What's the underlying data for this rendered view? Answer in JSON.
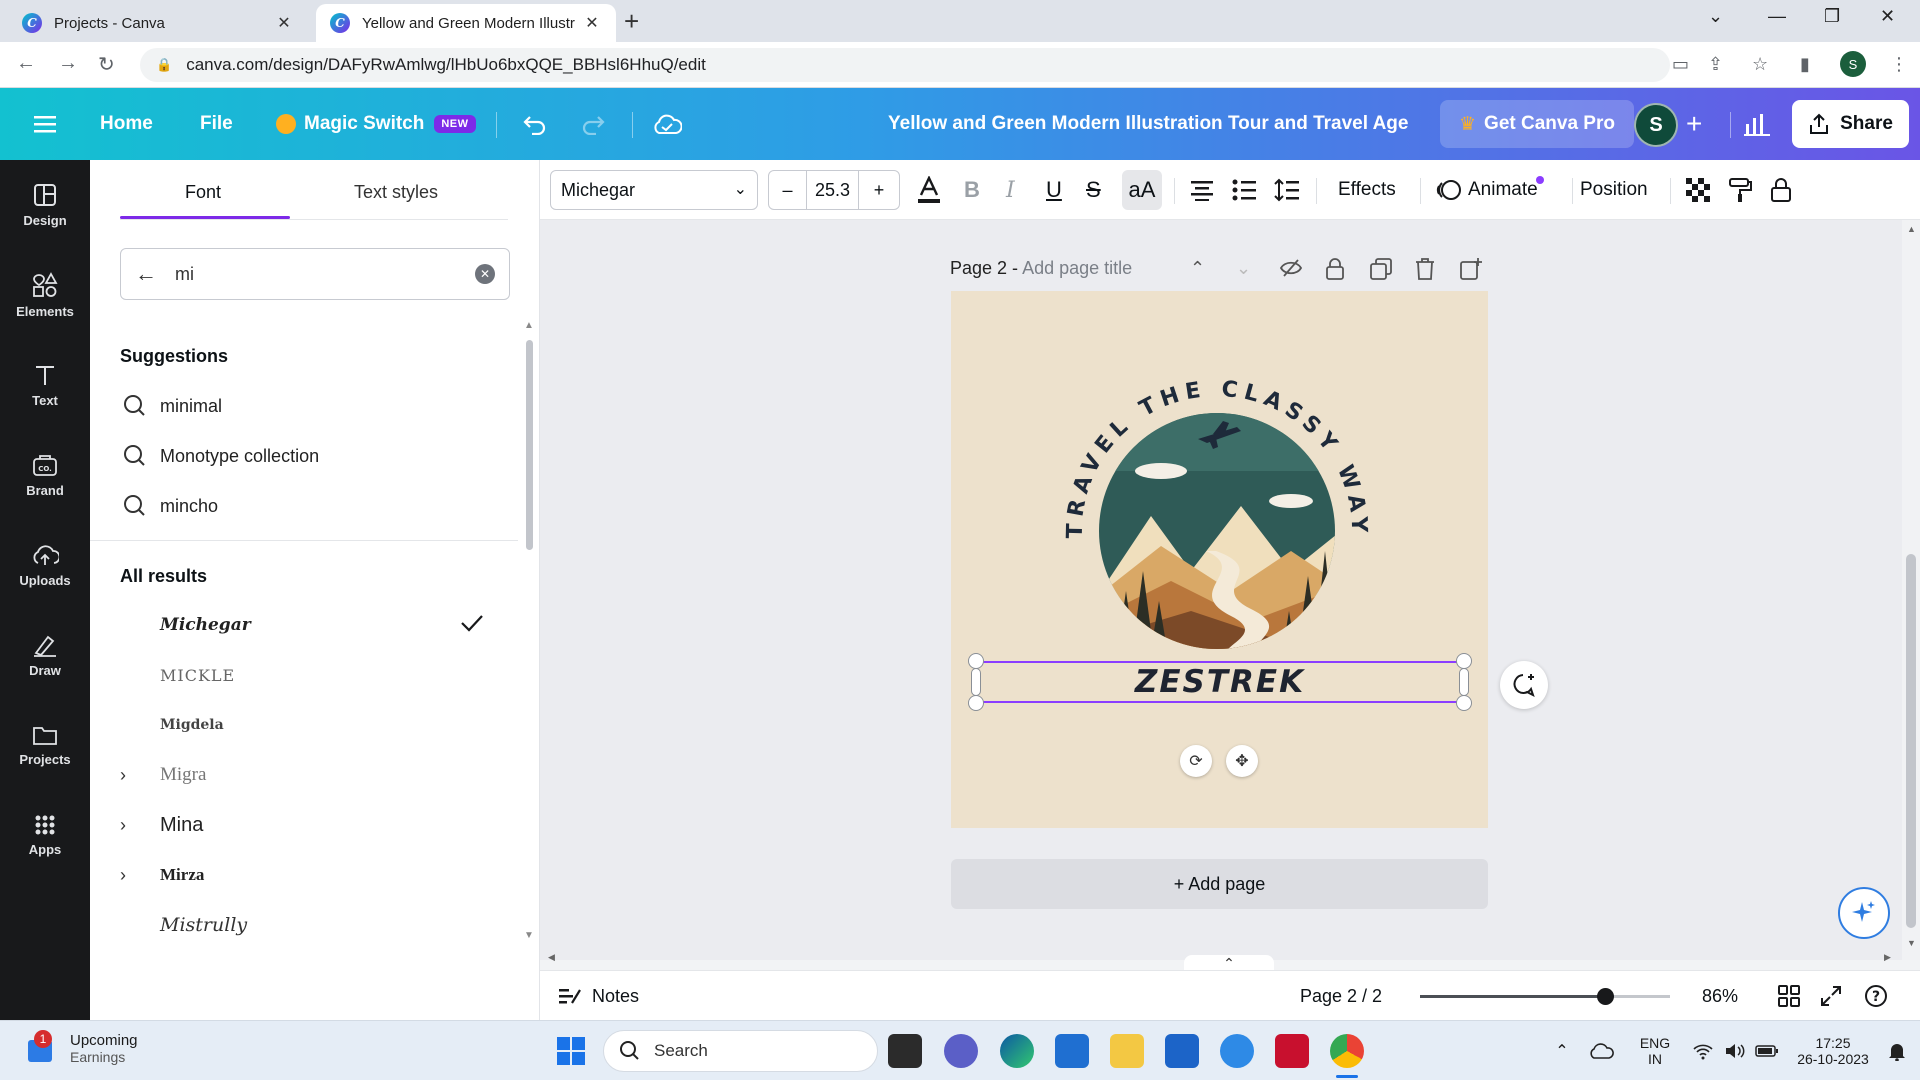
{
  "browser": {
    "tabs": [
      {
        "title": "Projects - Canva"
      },
      {
        "title": "Yellow and Green Modern Illustr"
      }
    ],
    "url": "canva.com/design/DAFyRwAmlwg/lHbUo6bxQQE_BBHsl6HhuQ/edit",
    "profile_initial": "S"
  },
  "header": {
    "home": "Home",
    "file": "File",
    "magic_switch": "Magic Switch",
    "new_badge": "NEW",
    "design_title": "Yellow and Green Modern Illustration Tour and Travel Agen...",
    "get_pro": "Get Canva Pro",
    "avatar_initial": "S",
    "share": "Share"
  },
  "rail": {
    "items": [
      {
        "label": "Design",
        "icon": "design-icon"
      },
      {
        "label": "Elements",
        "icon": "elements-icon"
      },
      {
        "label": "Text",
        "icon": "text-icon"
      },
      {
        "label": "Brand",
        "icon": "brand-icon"
      },
      {
        "label": "Uploads",
        "icon": "uploads-icon"
      },
      {
        "label": "Draw",
        "icon": "draw-icon"
      },
      {
        "label": "Projects",
        "icon": "projects-icon"
      },
      {
        "label": "Apps",
        "icon": "apps-icon"
      }
    ]
  },
  "panel": {
    "tab_font": "Font",
    "tab_text_styles": "Text styles",
    "search_value": "mi",
    "suggestions_title": "Suggestions",
    "suggestions": [
      "minimal",
      "Monotype collection",
      "mincho"
    ],
    "all_results_title": "All results",
    "fonts": [
      {
        "name": "Michegar",
        "selected": true,
        "expandable": false
      },
      {
        "name": "MICKLE",
        "selected": false,
        "expandable": false
      },
      {
        "name": "Migdela",
        "selected": false,
        "expandable": false
      },
      {
        "name": "Migra",
        "selected": false,
        "expandable": true
      },
      {
        "name": "Mina",
        "selected": false,
        "expandable": true
      },
      {
        "name": "Mirza",
        "selected": false,
        "expandable": true
      },
      {
        "name": "Mistrully",
        "selected": false,
        "expandable": false
      }
    ]
  },
  "toolbar": {
    "font_name": "Michegar",
    "font_size": "25.3",
    "minus": "–",
    "plus": "+",
    "effects": "Effects",
    "animate": "Animate",
    "position": "Position",
    "case_label": "aA"
  },
  "canvas": {
    "page_label": "Page 2 -",
    "page_title_placeholder": "Add page title",
    "logo_arc_text": "TRAVEL THE CLASSY WAY",
    "selected_text": "ZESTREK",
    "add_page": "+ Add page"
  },
  "bottom": {
    "notes": "Notes",
    "page_indicator": "Page 2 / 2",
    "zoom": "86%",
    "zoom_fraction": 0.74
  },
  "taskbar": {
    "weather_title": "Upcoming",
    "weather_sub": "Earnings",
    "notification_count": "1",
    "search_placeholder": "Search",
    "lang_top": "ENG",
    "lang_bottom": "IN",
    "time": "17:25",
    "date": "26-10-2023"
  },
  "colors": {
    "accent_purple": "#8b3dff",
    "header_start": "#13c1d0",
    "header_end": "#6a55e6",
    "page_bg": "#ede1cc",
    "logo_text": "#1e2a3a"
  }
}
